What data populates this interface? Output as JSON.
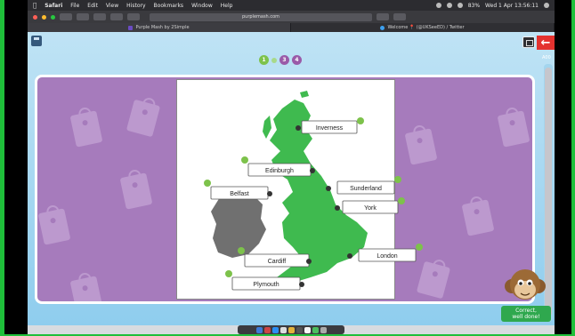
{
  "menubar": {
    "app": "Safari",
    "items": [
      "File",
      "Edit",
      "View",
      "History",
      "Bookmarks",
      "Window",
      "Help"
    ],
    "battery": "83%",
    "clock": "Wed 1 Apr  13:56:11"
  },
  "browser": {
    "address": "purplemash.com",
    "tabs": [
      {
        "title": "Purple Mash by 2Simple"
      },
      {
        "title": "Welcome 📍 (@UKSeeED) / Twitter"
      }
    ]
  },
  "app": {
    "progress": [
      "1",
      "",
      "3",
      "4"
    ],
    "corner_label": "A00",
    "labels": {
      "inverness": "Inverness",
      "edinburgh": "Edinburgh",
      "sunderland": "Sunderland",
      "belfast": "Belfast",
      "york": "York",
      "cardiff": "Cardiff",
      "london": "London",
      "plymouth": "Plymouth"
    },
    "feedback_line1": "Correct,",
    "feedback_line2": "well done!"
  },
  "colors": {
    "board": "#a67bbc",
    "gb_land": "#3fba4f",
    "ireland_land": "#707070",
    "label_fill": "#ffffff",
    "check": "#7dc24b",
    "back_button": "#e4322f"
  },
  "icons": {
    "save": "floppy-disk-icon",
    "back": "back-arrow-icon",
    "print": "print-icon",
    "check": "check-icon",
    "pin": "location-pin-icon",
    "tag": "price-tag-icon"
  }
}
